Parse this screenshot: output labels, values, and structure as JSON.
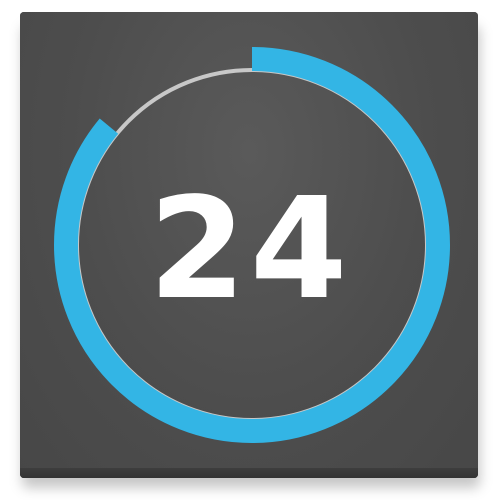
{
  "counter": {
    "value": "24",
    "progress_fraction": 0.86
  },
  "colors": {
    "tile": "#4e4e4e",
    "progress": "#33b5e5",
    "track": "#c8c8c8",
    "text": "#ffffff"
  }
}
